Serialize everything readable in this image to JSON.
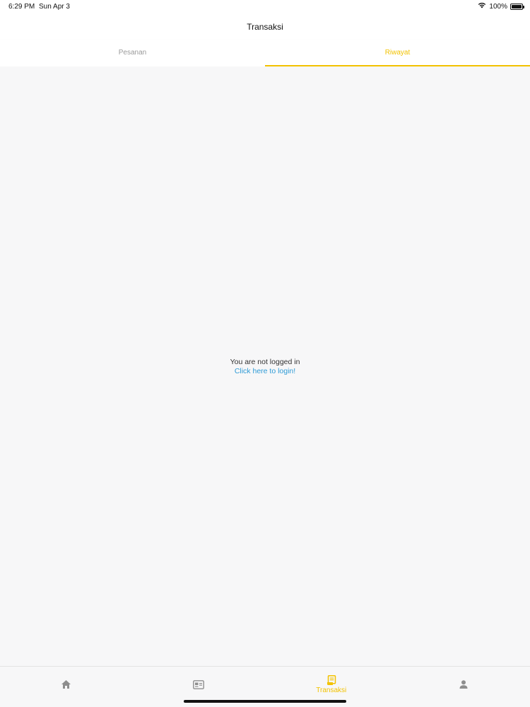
{
  "status_bar": {
    "time": "6:29 PM",
    "date": "Sun Apr 3",
    "battery": "100%",
    "icons": [
      "wifi-icon",
      "battery-icon"
    ]
  },
  "header": {
    "title": "Transaksi"
  },
  "tabs": [
    {
      "label": "Pesanan",
      "active": false
    },
    {
      "label": "Riwayat",
      "active": true
    }
  ],
  "main": {
    "message": "You are not logged in",
    "login_link": "Click here to login!"
  },
  "bottom_nav": {
    "items": [
      {
        "icon": "home-icon",
        "label": ""
      },
      {
        "icon": "card-icon",
        "label": ""
      },
      {
        "icon": "receipt-icon",
        "label": "Transaksi",
        "active": true
      },
      {
        "icon": "person-icon",
        "label": ""
      }
    ]
  },
  "colors": {
    "accent": "#f2c200",
    "link": "#2f9bd6",
    "inactive": "#9a9a9a",
    "background": "#f7f7f8"
  }
}
